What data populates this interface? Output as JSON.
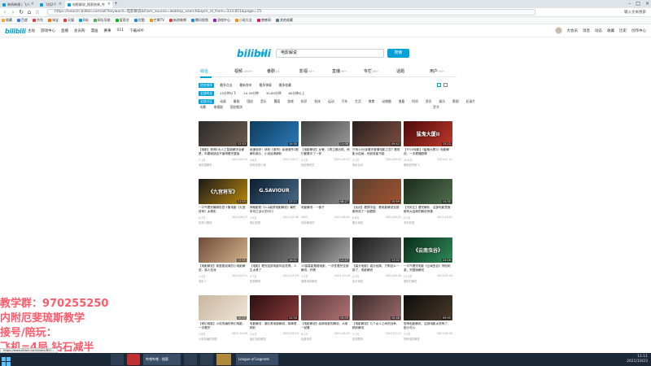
{
  "browser": {
    "tabs": [
      {
        "label": "神鸦神通 | 飞人"
      },
      {
        "label": "飞机2个"
      },
      {
        "label": "电影解说_搜索结果_哔"
      }
    ],
    "url": "https://search.bilibili.com/all?keyword=电影解说&from_source=webtop_search&spm_id_from=333.851&page=15",
    "toolbar_right": "输入文本搜索",
    "bookmarks": [
      "收藏",
      "百度",
      "京东",
      "淘宝",
      "天猫",
      "B站",
      "网址导航",
      "爱奇艺",
      "优酷",
      "芒果TV",
      "新浪微博",
      "腾讯视频",
      "游戏中心",
      "小说大全",
      "慈善网",
      "其他收藏"
    ]
  },
  "bili_header": {
    "logo": "bilibili",
    "nav": [
      "主站",
      "游戏中心",
      "直播",
      "会员购",
      "漫画",
      "赛事",
      "S11",
      "下载APP"
    ],
    "right": [
      "大会员",
      "消息",
      "动态",
      "收藏",
      "历史",
      "创作中心"
    ]
  },
  "search": {
    "logo": "bilibili",
    "logo_sub": "搜索",
    "value": "电影解说",
    "button": "搜索"
  },
  "result_tabs": [
    {
      "label": "综合",
      "count": ""
    },
    {
      "label": "视频",
      "count": "1000+"
    },
    {
      "label": "番剧",
      "count": "45"
    },
    {
      "label": "影视",
      "count": "99+"
    },
    {
      "label": "直播",
      "count": "99+"
    },
    {
      "label": "专栏",
      "count": "99+"
    },
    {
      "label": "话题",
      "count": ""
    },
    {
      "label": "用户",
      "count": "99+"
    }
  ],
  "filters": {
    "sort": [
      "综合排序",
      "最多点击",
      "最新发布",
      "最多弹幕",
      "最多收藏"
    ],
    "duration": [
      "全部时长",
      "10分钟以下",
      "10-30分钟",
      "30-60分钟",
      "60分钟以上"
    ],
    "zones": [
      "全部分区",
      "动画",
      "番剧",
      "国创",
      "音乐",
      "舞蹈",
      "游戏",
      "知识",
      "科技",
      "运动",
      "汽车",
      "生活",
      "美食",
      "动物圈",
      "鬼畜",
      "时尚",
      "资讯",
      "娱乐",
      "影视",
      "纪录片"
    ],
    "zones2": [
      "电影",
      "电视剧",
      "国创相关"
    ],
    "more": "更多"
  },
  "videos": [
    {
      "title": "【电影】死神1为人工智能解决全都是，你要继续这不值得看完整版",
      "views": "1.1万",
      "date": "2021-08-15",
      "up": "电影猫解说",
      "duration": "12:53",
      "overlay": ""
    },
    {
      "title": "疾速追杀！林林《追杀》疾速追杀2都解析爽片，小说经典解析",
      "views": "4.6万",
      "date": "2021-10-17",
      "up": "说电影的小狼",
      "duration": "10:35",
      "overlay": ""
    },
    {
      "title": "【电影解说】女警、2男主都出现，他们都看中了一样",
      "views": "3.2万",
      "date": "2021-09-27",
      "up": "电影解说员",
      "duration": "11:08",
      "overlay": ""
    },
    {
      "title": "只有10分钟看完爱情电影之恋？看电影大结局，他到底能不能",
      "views": "2.1万",
      "date": "2021-09-03",
      "up": "电影杂谈",
      "duration": "09:42",
      "overlay": ""
    },
    {
      "title": "【FF15电影】《猛鬼大厦2》电影解说，一次看懂剧情",
      "views": "10.8万",
      "date": "2021-07-21",
      "up": "看电影的阿飞",
      "duration": "15:22",
      "overlay": "猛鬼大厦II"
    },
    {
      "title": "一口气看完最精彩四十集电影《九宫将军》太精彩",
      "views": "5.3万",
      "date": "2021-06-12",
      "up": "影视小剧场",
      "duration": "21:03",
      "overlay": "《九宫将军》"
    },
    {
      "title": "神秘影院《G.S级别电影解说》最终系列之战斗的口口",
      "views": "1.9万",
      "date": "2021-05-08",
      "up": "奇幻影院",
      "duration": "13:11",
      "overlay": "G.SAVIOUR"
    },
    {
      "title": "电影解说：一部子",
      "views": "4925",
      "date": "2021-08-01",
      "up": "电影解说的",
      "duration": "08:27",
      "overlay": ""
    },
    {
      "title": "【女优】看穿宇宙，看电影解说全部都来到了一起看剧",
      "views": "6.6万",
      "date": "2021-09-21",
      "up": "看点电影",
      "duration": "10:59",
      "overlay": ""
    },
    {
      "title": "【天际生】看完解析，这部电影里面都有大结局的解说惊喜",
      "views": "2.2万",
      "date": "2021-10-02",
      "up": "天际影视",
      "duration": "14:30",
      "overlay": ""
    },
    {
      "title": "【电影解说】家庭剧经典的小电影解说，感人至深",
      "views": "1.4万",
      "date": "2021-04-11",
      "up": "电影人",
      "duration": "12:05",
      "overlay": ""
    },
    {
      "title": "【电影】看完这部电影你会觉得，人生太难了",
      "views": "3.7万",
      "date": "2021-03-19",
      "up": "影视解说",
      "duration": "16:41",
      "overlay": ""
    },
    {
      "title": "13部高能悬疑电影，一次性看完全部解说，好看",
      "views": "7.3万",
      "date": "2021-10-18",
      "up": "悬疑电影解说",
      "duration": "11:47",
      "overlay": ""
    },
    {
      "title": "【高分电影】高分经典，只剩这么一部了，电影解说",
      "views": "4.4万",
      "date": "2021-09-30",
      "up": "高分电影",
      "duration": "13:02",
      "overlay": ""
    },
    {
      "title": "一口气看完电影《云南虫谷》惊险刺激，完整版解说",
      "views": "22.4万",
      "date": "2021-09-04",
      "up": "鬼吹灯解说",
      "duration": "24:16",
      "overlay": "《云南虫谷》"
    },
    {
      "title": "【奇幻电影】小说改编的奇幻电影，一次看完",
      "views": "1.6万",
      "date": "2021-10-09",
      "up": "小说改编的电影",
      "duration": "10:22",
      "overlay": ""
    },
    {
      "title": "电影解说：魔幻类电影解说，故事很精彩",
      "views": "3.0万",
      "date": "2021-09-15",
      "up": "魔幻电影解说",
      "duration": "12:34",
      "overlay": ""
    },
    {
      "title": "【电影解说】经典电影的解说，大家一起看",
      "views": "8.1万",
      "date": "2021-08-22",
      "up": "经典电影",
      "duration": "15:09",
      "overlay": ""
    },
    {
      "title": "【电影解说】几个女人之间的战争，精彩解说",
      "views": "2.7万",
      "date": "2021-07-13",
      "up": "影视剧场",
      "duration": "10:48",
      "overlay": ""
    },
    {
      "title": "恐怖电影解说，这部电影太恐怖了，胆小勿入",
      "views": "5.5万",
      "date": "2021-06-28",
      "up": "恐怖电影解说",
      "duration": "09:55",
      "overlay": ""
    }
  ],
  "stream_overlay": {
    "line1": "教学群：970255250",
    "line2": "内附厄斐琉斯教学",
    "line3": "接号/陪玩：",
    "line4": "飞机=4局 钻石减半"
  },
  "status_url": "https://www.bilibili.com/video/BV1...",
  "taskbar": {
    "items": [
      "哔哩哔哩 - 搜索",
      "League of Legends"
    ],
    "time": "11:11",
    "date": "2021/10/23"
  }
}
